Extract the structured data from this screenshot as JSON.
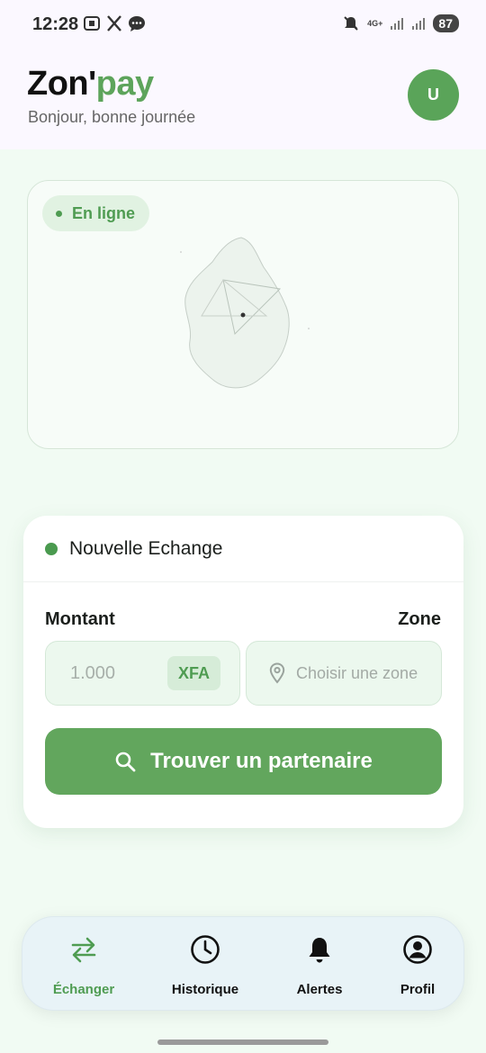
{
  "status_bar": {
    "time": "12:28",
    "network": "4G+",
    "battery": "87",
    "icons_left": [
      "screenshot-icon",
      "x-icon",
      "message-icon"
    ],
    "icons_right": [
      "mute-icon",
      "signal-icon",
      "signal-icon",
      "battery-icon"
    ]
  },
  "header": {
    "brand_part1": "Zon'",
    "brand_part2": "pay",
    "greeting": "Bonjour, bonne journée",
    "avatar_initial": "U"
  },
  "map": {
    "status_label": "En ligne"
  },
  "exchange": {
    "title": "Nouvelle Echange",
    "amount_label": "Montant",
    "zone_label": "Zone",
    "amount_placeholder": "1.000",
    "currency": "XFA",
    "zone_placeholder": "Choisir une zone",
    "find_button": "Trouver un partenaire"
  },
  "nav": {
    "items": [
      {
        "label": "Échanger",
        "icon": "exchange-arrows-icon",
        "active": true
      },
      {
        "label": "Historique",
        "icon": "clock-icon",
        "active": false
      },
      {
        "label": "Alertes",
        "icon": "bell-icon",
        "active": false
      },
      {
        "label": "Profil",
        "icon": "user-circle-icon",
        "active": false
      }
    ]
  },
  "colors": {
    "brand_green": "#5da45b",
    "button_green": "#62a65d",
    "background": "#f1fbf3",
    "header_bg": "#fbf8ff"
  }
}
